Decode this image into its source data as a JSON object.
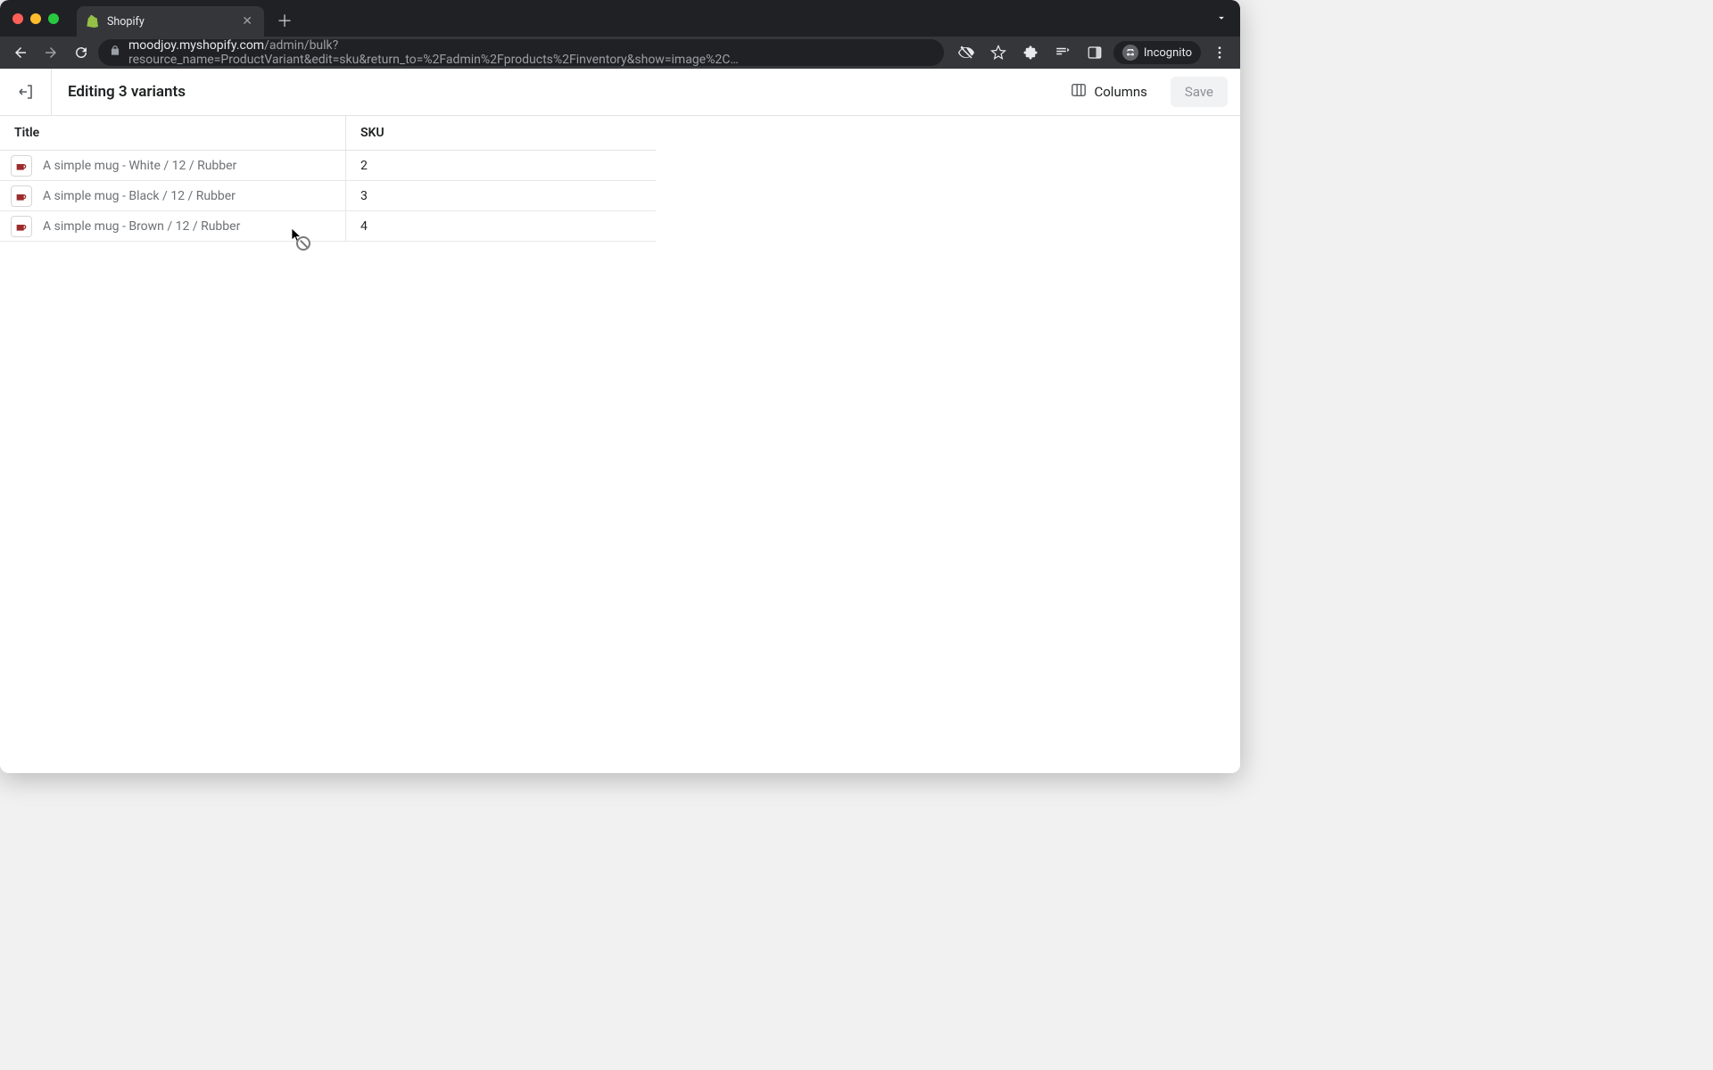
{
  "browser": {
    "tab_title": "Shopify",
    "url_host": "moodjoy.myshopify.com",
    "url_path": "/admin/bulk?resource_name=ProductVariant&edit=sku&return_to=%2Fadmin%2Fproducts%2Finventory&show=image%2C…",
    "incognito_label": "Incognito"
  },
  "header": {
    "title": "Editing 3 variants",
    "columns_label": "Columns",
    "save_label": "Save"
  },
  "table": {
    "columns": {
      "title": "Title",
      "sku": "SKU"
    },
    "rows": [
      {
        "title": "A simple mug - White / 12 / Rubber",
        "sku": "2"
      },
      {
        "title": "A simple mug - Black / 12 / Rubber",
        "sku": "3"
      },
      {
        "title": "A simple mug - Brown / 12 / Rubber",
        "sku": "4"
      }
    ]
  }
}
